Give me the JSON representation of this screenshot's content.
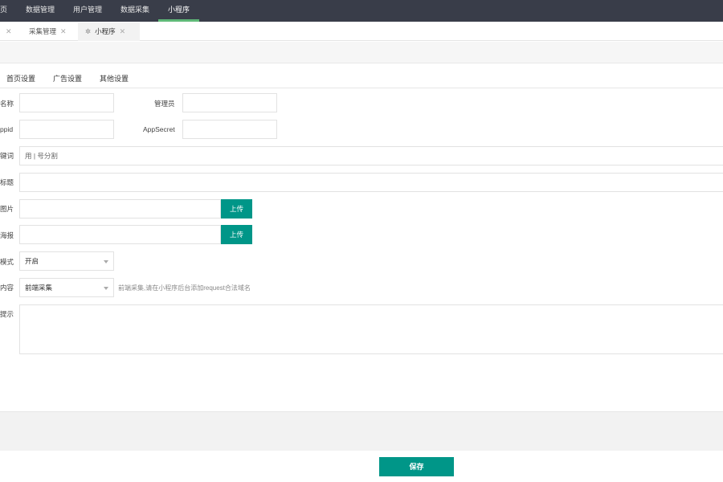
{
  "topnav": {
    "items": [
      "页",
      "数据管理",
      "用户管理",
      "数据采集",
      "小程序"
    ],
    "active_index": 4
  },
  "tabs": {
    "items": [
      {
        "label": "",
        "closable": true
      },
      {
        "label": "采集管理",
        "closable": true
      },
      {
        "label": "小程序",
        "closable": true,
        "active": true
      }
    ],
    "refresh_glyph": "✲"
  },
  "subtabs": [
    "首页设置",
    "广告设置",
    "其他设置"
  ],
  "form": {
    "name_label": "名称",
    "admin_label": "管理员",
    "appid_label": "ppid",
    "appsecret_label": "AppSecret",
    "keywords_label": "键词",
    "keywords_placeholder": "用 | 号分割",
    "title_label": "标题",
    "image_label": "图片",
    "poster_label": "海报",
    "upload_label": "上传",
    "mode_label": "模式",
    "mode_value": "开启",
    "content_label": "内容",
    "content_value": "前端采集",
    "content_hint": "前端采集,请在小程序后台添加request合法域名",
    "notice_label": "提示"
  },
  "save_label": "保存",
  "colors": {
    "topnav_bg": "#393d49",
    "active_underline": "#5fb878",
    "primary_button": "#009688"
  },
  "icons": [
    "close-icon",
    "refresh-icon",
    "caret-down-icon"
  ]
}
